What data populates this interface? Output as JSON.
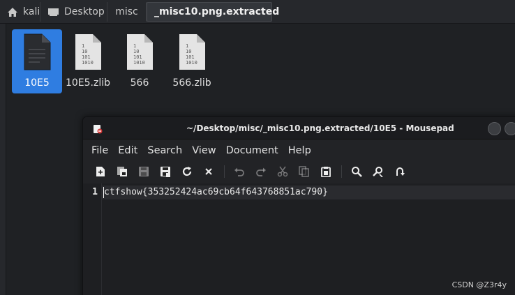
{
  "file_manager": {
    "breadcrumbs": [
      {
        "label": "kali",
        "icon": "home-icon"
      },
      {
        "label": "Desktop",
        "icon": "folder-desktop-icon"
      },
      {
        "label": "misc"
      },
      {
        "label": "_misc10.png.extracted"
      }
    ],
    "files": [
      {
        "name": "10E5",
        "icon": "text-file-icon",
        "selected": true
      },
      {
        "name": "10E5.zlib",
        "icon": "binary-file-icon"
      },
      {
        "name": "566",
        "icon": "binary-file-icon"
      },
      {
        "name": "566.zlib",
        "icon": "binary-file-icon"
      }
    ],
    "binary_icon_text": [
      "1",
      "10",
      "101",
      "1010"
    ]
  },
  "mousepad": {
    "title": "~/Desktop/misc/_misc10.png.extracted/10E5 - Mousepad",
    "menu": [
      "File",
      "Edit",
      "Search",
      "View",
      "Document",
      "Help"
    ],
    "toolbar": [
      "new-document-icon",
      "new-window-icon",
      "save-icon",
      "save-as-icon",
      "reload-icon",
      "close-icon",
      "undo-icon",
      "redo-icon",
      "cut-icon",
      "copy-icon",
      "paste-icon",
      "find-icon",
      "find-replace-icon",
      "go-to-line-icon"
    ],
    "line_number": "1",
    "content": "ctfshow{353252424ac69cb64f643768851ac790}"
  },
  "watermark": "CSDN @Z3r4y",
  "colors": {
    "selection": "#2f7de1",
    "background": "#1e1f22"
  }
}
